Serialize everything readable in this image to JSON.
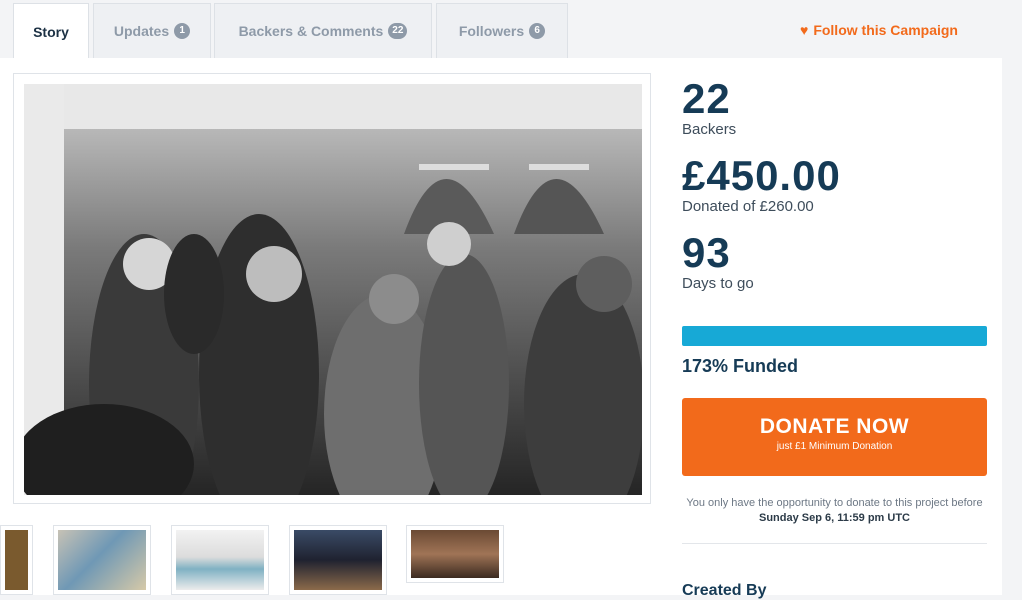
{
  "tabs": [
    {
      "label": "Story",
      "badge": null
    },
    {
      "label": "Updates",
      "badge": "1"
    },
    {
      "label": "Backers & Comments",
      "badge": "22"
    },
    {
      "label": "Followers",
      "badge": "6"
    }
  ],
  "follow": {
    "label": "Follow this Campaign",
    "icon": "heart-icon"
  },
  "stats": {
    "backers_value": "22",
    "backers_label": "Backers",
    "donated_value": "£450.00",
    "donated_label": "Donated of £260.00",
    "days_value": "93",
    "days_label": "Days to go"
  },
  "progress": {
    "percent": 100
  },
  "funded_label": "173% Funded",
  "donate": {
    "label": "DONATE NOW",
    "sublabel": "just £1 Minimum Donation"
  },
  "deadline_note": {
    "text": "You only have the opportunity to donate to this project before",
    "date": "Sunday Sep 6, 11:59 pm UTC"
  },
  "created_by": "Created By",
  "colors": {
    "accent": "#f26a1b",
    "progress": "#17a9d6",
    "heading": "#163b56"
  }
}
